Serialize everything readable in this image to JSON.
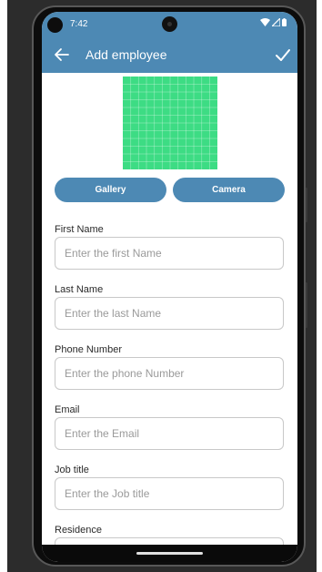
{
  "status_bar": {
    "time": "7:42",
    "icons": [
      "wifi-icon",
      "signal-icon",
      "battery-icon"
    ]
  },
  "app_bar": {
    "title": "Add employee",
    "back_icon": "arrow-back-icon",
    "confirm_icon": "check-icon",
    "color": "#4d89b4"
  },
  "photo": {
    "color": "#3ddc84"
  },
  "buttons": {
    "gallery": "Gallery",
    "camera": "Camera"
  },
  "form": {
    "fields": [
      {
        "label": "First Name",
        "placeholder": "Enter the first Name",
        "value": ""
      },
      {
        "label": "Last Name",
        "placeholder": "Enter the last Name",
        "value": ""
      },
      {
        "label": "Phone Number",
        "placeholder": "Enter the phone Number",
        "value": ""
      },
      {
        "label": "Email",
        "placeholder": "Enter the Email",
        "value": ""
      },
      {
        "label": "Job title",
        "placeholder": "Enter the Job title",
        "value": ""
      },
      {
        "label": "Residence",
        "placeholder": "",
        "value": ""
      }
    ]
  }
}
